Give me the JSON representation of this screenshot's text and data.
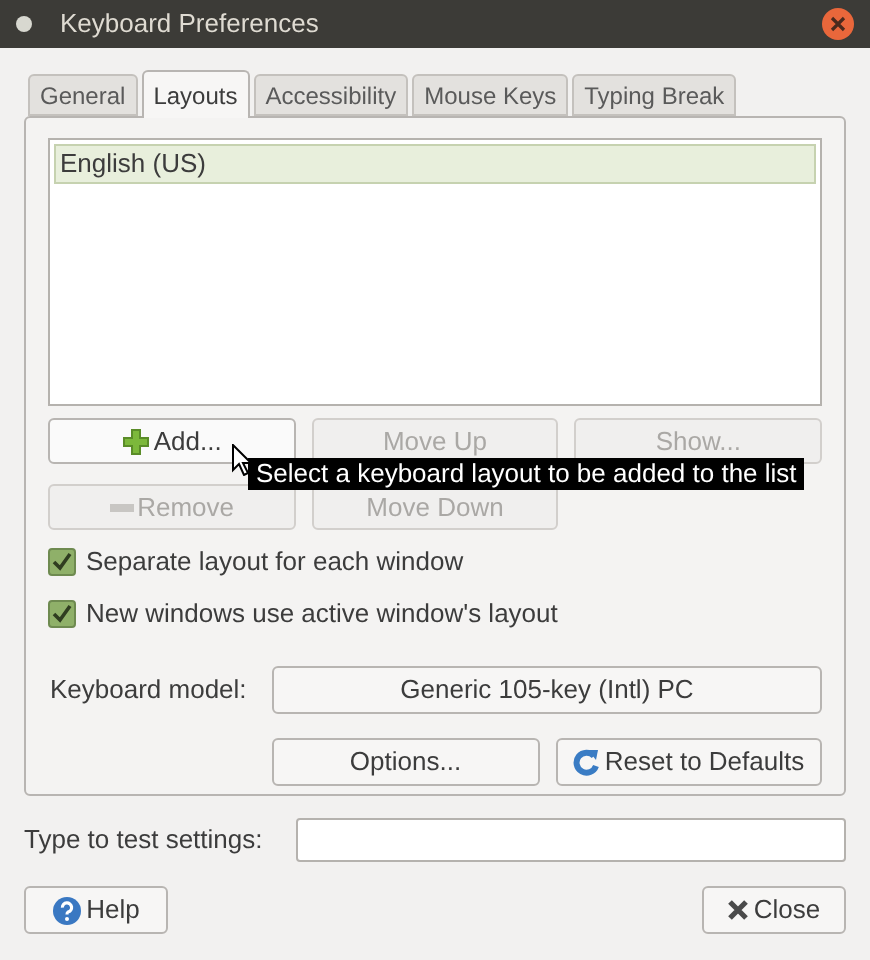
{
  "window": {
    "title": "Keyboard Preferences"
  },
  "tabs": [
    {
      "label": "General",
      "selected": false
    },
    {
      "label": "Layouts",
      "selected": true
    },
    {
      "label": "Accessibility",
      "selected": false
    },
    {
      "label": "Mouse Keys",
      "selected": false
    },
    {
      "label": "Typing Break",
      "selected": false
    }
  ],
  "layouts_list": [
    {
      "label": "English (US)",
      "selected": true
    }
  ],
  "layout_buttons": [
    {
      "label": "Add...",
      "disabled": false
    },
    {
      "label": "Move Up",
      "disabled": true
    },
    {
      "label": "Show...",
      "disabled": true
    },
    {
      "label": "Remove",
      "disabled": true
    },
    {
      "label": "Move Down",
      "disabled": true
    }
  ],
  "tooltip": "Select a keyboard layout to be added to the list",
  "checkboxes": [
    {
      "label": "Separate layout for each window",
      "checked": true
    },
    {
      "label": "New windows use active window's layout",
      "checked": true
    }
  ],
  "keyboard_model": {
    "label": "Keyboard model:",
    "value": "Generic 105-key (Intl) PC"
  },
  "options_button": "Options...",
  "reset_button": "Reset to Defaults",
  "test_field": {
    "label": "Type to test settings:"
  },
  "help_button": "Help",
  "close_button": "Close"
}
